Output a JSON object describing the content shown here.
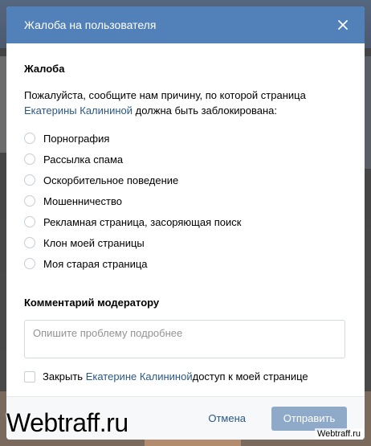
{
  "dialog": {
    "title": "Жалоба на пользователя",
    "close_icon": "close-icon"
  },
  "complaint": {
    "section_title": "Жалоба",
    "prompt_before": "Пожалуйста, сообщите нам причину, по которой страница ",
    "user_link": "Екатерины Калининой",
    "prompt_after": " должна быть заблокирована:",
    "options": [
      "Порнография",
      "Рассылка спама",
      "Оскорбительное поведение",
      "Мошенничество",
      "Рекламная страница, засоряющая поиск",
      "Клон моей страницы",
      "Моя старая страница"
    ]
  },
  "comment": {
    "section_title": "Комментарий модератору",
    "placeholder": "Опишите проблему подробнее",
    "value": ""
  },
  "close_access": {
    "label_before": "Закрыть ",
    "user_link": "Екатерине Калининой",
    "label_after": " доступ к моей странице",
    "checked": false
  },
  "footer": {
    "cancel_label": "Отмена",
    "submit_label": "Отправить"
  },
  "watermarks": {
    "left": "Webtraff.ru",
    "right": "Webtraff.ru"
  },
  "colors": {
    "header": "#5181b8",
    "link": "#2a5885",
    "submit_disabled": "#8fa9c8"
  }
}
